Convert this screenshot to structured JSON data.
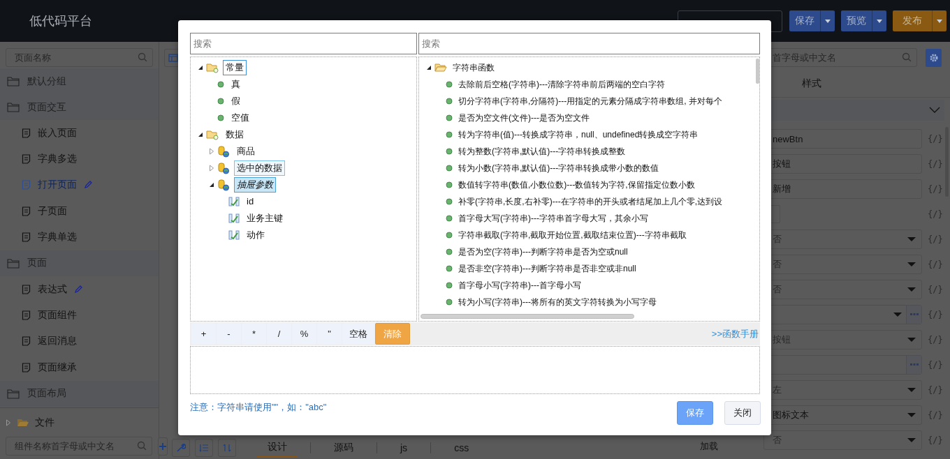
{
  "header": {
    "logo": "低代码平台",
    "actions": [
      {
        "label": "保存",
        "kind": "primary"
      },
      {
        "label": "预览",
        "kind": "primary"
      },
      {
        "label": "发布",
        "kind": "warning"
      }
    ]
  },
  "sidebar": {
    "search": {
      "placeholder": "页面名称"
    },
    "groups": [
      {
        "label": "默认分组"
      },
      {
        "label": "页面交互",
        "items": [
          {
            "label": "嵌入页面",
            "selected": false,
            "edited": false
          },
          {
            "label": "字典多选",
            "selected": false,
            "edited": false
          },
          {
            "label": "打开页面",
            "selected": true,
            "edited": true
          },
          {
            "label": "子页面",
            "selected": false,
            "edited": false
          },
          {
            "label": "字典单选",
            "selected": false,
            "edited": false
          }
        ]
      },
      {
        "label": "页面",
        "items": [
          {
            "label": "表达式",
            "selected": false,
            "edited": true
          },
          {
            "label": "页面组件",
            "selected": false,
            "edited": false
          },
          {
            "label": "返回消息",
            "selected": false,
            "edited": false
          },
          {
            "label": "页面继承",
            "selected": false,
            "edited": false
          }
        ]
      },
      {
        "label": "页面布局"
      }
    ],
    "files": {
      "label": "文件",
      "expanded": false
    },
    "component_search": {
      "placeholder": "组件名称首字母或中文名"
    }
  },
  "editor_tabs": [
    {
      "label": "设计",
      "selected": true
    },
    {
      "label": "源码",
      "selected": false
    },
    {
      "label": "js",
      "selected": false
    },
    {
      "label": "css",
      "selected": false
    }
  ],
  "properties": {
    "search": {
      "placeholder": "首字母或中文名"
    },
    "tabs": [
      {
        "label": "样式",
        "selected": false
      }
    ],
    "rows": [
      {
        "kind": "input",
        "value": "newBtn",
        "bind": "{/}"
      },
      {
        "kind": "input",
        "value": "按钮",
        "bind": "{/}"
      },
      {
        "kind": "input",
        "value": "新增",
        "bind": "{/}"
      },
      {
        "kind": "box",
        "bind": "{/}"
      },
      {
        "kind": "select",
        "placeholder": "否",
        "bind": "{/}"
      },
      {
        "kind": "select",
        "placeholder": "否",
        "bind": "{/}"
      },
      {
        "kind": "select",
        "placeholder": "否",
        "bind": "{/}"
      },
      {
        "kind": "select-more",
        "bind": "{/}"
      },
      {
        "kind": "select",
        "placeholder": "按钮",
        "bind": "{/}"
      },
      {
        "kind": "input-more",
        "bind": "{/}"
      },
      {
        "kind": "select",
        "placeholder": "左",
        "bind": "{/}"
      },
      {
        "kind": "select",
        "value": "图标文本",
        "bind": "{/}"
      },
      {
        "kind": "select",
        "label": "加载",
        "placeholder": "否",
        "bind": "{/}"
      }
    ]
  },
  "dialog": {
    "left_search": {
      "placeholder": "搜索"
    },
    "right_search": {
      "placeholder": "搜索"
    },
    "left_tree": [
      {
        "label": "常量",
        "kind": "folder",
        "expanded": true,
        "selected": false,
        "focused": true,
        "hovered": false,
        "children": [
          {
            "label": "真",
            "kind": "constant",
            "selected": false,
            "focused": false,
            "hovered": false
          },
          {
            "label": "假",
            "kind": "constant",
            "selected": false,
            "focused": false,
            "hovered": false
          },
          {
            "label": "空值",
            "kind": "constant",
            "selected": false,
            "focused": false,
            "hovered": false
          }
        ]
      },
      {
        "label": "数据",
        "kind": "folder",
        "expanded": true,
        "selected": false,
        "focused": false,
        "hovered": false,
        "children": [
          {
            "label": "商品",
            "kind": "datasource",
            "expanded": false,
            "selected": false,
            "focused": false,
            "hovered": false
          },
          {
            "label": "选中的数据",
            "kind": "datasource",
            "expanded": false,
            "selected": false,
            "focused": false,
            "hovered": true
          },
          {
            "label": "抽屉参数",
            "kind": "datasource",
            "expanded": true,
            "selected": true,
            "focused": false,
            "hovered": false,
            "children": [
              {
                "label": "id",
                "kind": "field",
                "selected": false,
                "focused": false,
                "hovered": false
              },
              {
                "label": "业务主键",
                "kind": "field",
                "selected": false,
                "focused": false,
                "hovered": false
              },
              {
                "label": "动作",
                "kind": "field",
                "selected": false,
                "focused": false,
                "hovered": false
              }
            ]
          }
        ]
      }
    ],
    "right_tree": [
      {
        "label": "字符串函数",
        "kind": "open-folder",
        "expanded": true,
        "selected": false,
        "focused": false,
        "hovered": false,
        "children": [
          {
            "label": "去除前后空格(字符串)---清除字符串前后两端的空白字符",
            "kind": "constant",
            "selected": false,
            "focused": false,
            "hovered": false
          },
          {
            "label": "切分字符串(字符串,分隔符)---用指定的元素分隔成字符串数组, 并对每个",
            "kind": "constant",
            "selected": false,
            "focused": false,
            "hovered": false
          },
          {
            "label": "是否为空文件(文件)---是否为空文件",
            "kind": "constant",
            "selected": false,
            "focused": false,
            "hovered": false
          },
          {
            "label": "转为字符串(值)---转换成字符串，null、undefined转换成空字符串",
            "kind": "constant",
            "selected": false,
            "focused": false,
            "hovered": false
          },
          {
            "label": "转为整数(字符串,默认值)---字符串转换成整数",
            "kind": "constant",
            "selected": false,
            "focused": false,
            "hovered": false
          },
          {
            "label": "转为小数(字符串,默认值)---字符串转换成带小数的数值",
            "kind": "constant",
            "selected": false,
            "focused": false,
            "hovered": false
          },
          {
            "label": "数值转字符串(数值,小数位数)---数值转为字符,保留指定位数小数",
            "kind": "constant",
            "selected": false,
            "focused": false,
            "hovered": false
          },
          {
            "label": "补零(字符串,长度,右补零)---在字符串的开头或者结尾加上几个零,达到设",
            "kind": "constant",
            "selected": false,
            "focused": false,
            "hovered": false
          },
          {
            "label": "首字母大写(字符串)---字符串首字母大写，其余小写",
            "kind": "constant",
            "selected": false,
            "focused": false,
            "hovered": false
          },
          {
            "label": "字符串截取(字符串,截取开始位置,截取结束位置)---字符串截取",
            "kind": "constant",
            "selected": false,
            "focused": false,
            "hovered": false
          },
          {
            "label": "是否为空(字符串)---判断字符串是否为空或null",
            "kind": "constant",
            "selected": false,
            "focused": false,
            "hovered": false
          },
          {
            "label": "是否非空(字符串)---判断字符串是否非空或非null",
            "kind": "constant",
            "selected": false,
            "focused": false,
            "hovered": false
          },
          {
            "label": "首字母小写(字符串)---首字母小写",
            "kind": "constant",
            "selected": false,
            "focused": false,
            "hovered": false
          },
          {
            "label": "转为小写(字符串)---将所有的英文字符转换为小写字母",
            "kind": "constant",
            "selected": false,
            "focused": false,
            "hovered": false
          }
        ]
      }
    ],
    "operators": [
      {
        "label": "+",
        "kind": "operator"
      },
      {
        "label": "-",
        "kind": "operator"
      },
      {
        "label": "*",
        "kind": "operator"
      },
      {
        "label": "/",
        "kind": "operator"
      },
      {
        "label": "%",
        "kind": "operator"
      },
      {
        "label": "\"",
        "kind": "operator"
      },
      {
        "label": "空格",
        "kind": "operator"
      },
      {
        "label": "清除",
        "kind": "clear"
      }
    ],
    "manual_link": ">>函数手册",
    "note": "注意：字符串请使用\"\"，如：\"abc\"",
    "buttons": [
      {
        "label": "保存",
        "kind": "primary"
      },
      {
        "label": "关闭",
        "kind": "default"
      }
    ]
  }
}
